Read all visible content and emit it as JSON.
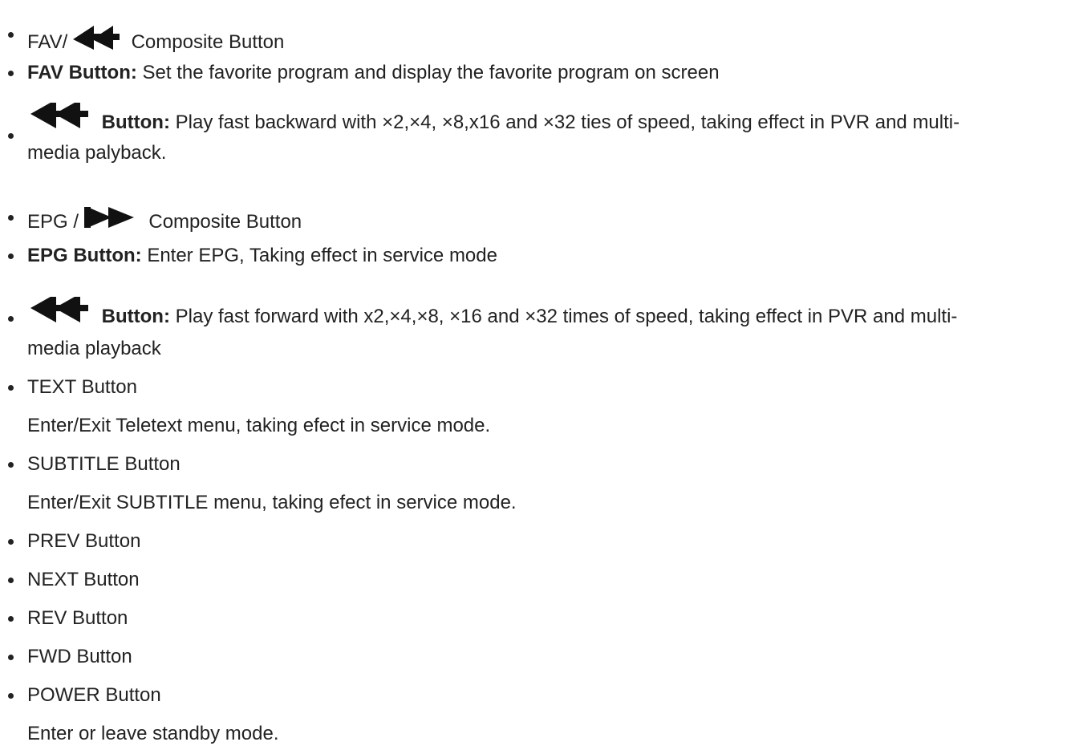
{
  "items": [
    {
      "prefix": "FAV/",
      "icon": "rewind-icon",
      "suffix": "Composite Button"
    },
    {
      "bold": "FAV Button:",
      "text": "Set the favorite program and display the favorite program on screen"
    },
    {
      "icon": "rewind-icon",
      "bold": "Button:",
      "text": "Play fast backward with ×2,×4, ×8,x16 and ×32 ties of speed, taking effect in PVR and multi-",
      "cont": "media palyback."
    },
    {
      "prefix": "EPG /",
      "icon": "fast-forward-icon",
      "suffix": "Composite Button"
    },
    {
      "bold": "EPG Button:",
      "text": "Enter EPG, Taking effect in service mode"
    },
    {
      "icon": "rewind-icon",
      "bold": "Button:",
      "text": "Play fast forward with x2,×4,×8, ×16 and ×32 times of speed, taking effect in PVR and multi-",
      "cont": "media playback"
    },
    {
      "text": "TEXT Button",
      "cont": "Enter/Exit Teletext menu, taking efect in service mode."
    },
    {
      "text": "SUBTITLE Button",
      "cont": "Enter/Exit SUBTITLE menu, taking efect in service mode."
    },
    {
      "text": "PREV Button"
    },
    {
      "text": "NEXT Button"
    },
    {
      "text": "REV Button"
    },
    {
      "text": "FWD Button"
    },
    {
      "text": "POWER Button",
      "cont": "Enter or leave standby mode."
    }
  ],
  "colors": {
    "text": "#222222",
    "icon": "#111111",
    "background": "#ffffff"
  }
}
